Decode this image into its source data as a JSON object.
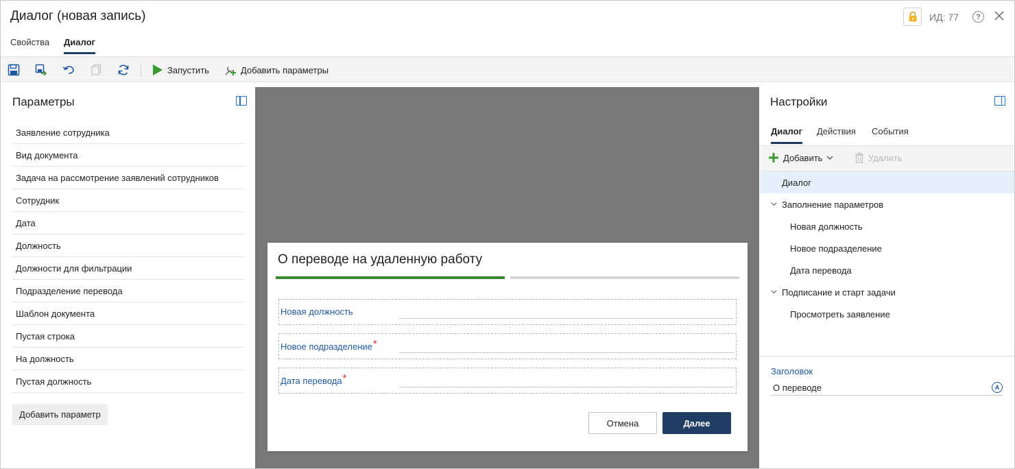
{
  "window": {
    "title": "Диалог (новая запись)",
    "id_label": "ИД: 77"
  },
  "top_tabs": [
    {
      "label": "Свойства",
      "active": false
    },
    {
      "label": "Диалог",
      "active": true
    }
  ],
  "toolbar": {
    "run_label": "Запустить",
    "add_params_label": "Добавить параметры"
  },
  "left_panel": {
    "title": "Параметры",
    "items": [
      "Заявление сотрудника",
      "Вид документа",
      "Задача на рассмотрение заявлений сотрудников",
      "Сотрудник",
      "Дата",
      "Должность",
      "Должности для фильтрации",
      "Подразделение перевода",
      "Шаблон документа",
      "Пустая строка",
      "На должность",
      "Пустая должность"
    ],
    "add_button_label": "Добавить параметр"
  },
  "dialog_preview": {
    "title": "О переводе на удаленную работу",
    "fields": [
      {
        "label": "Новая должность",
        "required": false
      },
      {
        "label": "Новое подразделение",
        "required": true
      },
      {
        "label": "Дата перевода",
        "required": true
      }
    ],
    "required_mark": "*",
    "cancel_label": "Отмена",
    "next_label": "Далее",
    "progress_steps": 2,
    "current_step": 1
  },
  "right_panel": {
    "title": "Настройки",
    "tabs": [
      {
        "label": "Диалог",
        "active": true
      },
      {
        "label": "Действия",
        "active": false
      },
      {
        "label": "События",
        "active": false
      }
    ],
    "add_label": "Добавить",
    "delete_label": "Удалить",
    "tree": [
      {
        "label": "Диалог",
        "level": 0,
        "selected": true,
        "expandable": false
      },
      {
        "label": "Заполнение параметров",
        "level": 0,
        "selected": false,
        "expandable": true
      },
      {
        "label": "Новая должность",
        "level": 1,
        "selected": false,
        "expandable": false
      },
      {
        "label": "Новое подразделение",
        "level": 1,
        "selected": false,
        "expandable": false
      },
      {
        "label": "Дата перевода",
        "level": 1,
        "selected": false,
        "expandable": false
      },
      {
        "label": "Подписание и старт задачи",
        "level": 0,
        "selected": false,
        "expandable": true
      },
      {
        "label": "Просмотреть заявление",
        "level": 1,
        "selected": false,
        "expandable": false
      }
    ],
    "property_label": "Заголовок",
    "property_value": "О переводе"
  },
  "colors": {
    "accent": "#1f3d63",
    "link": "#1f5aa0",
    "progress": "#3a8a2f",
    "required": "#dd3333",
    "preview_background": "#787878"
  }
}
